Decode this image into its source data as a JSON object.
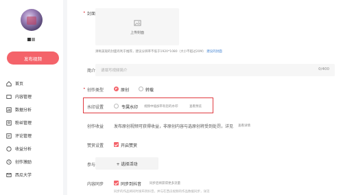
{
  "sidebar": {
    "publish_label": "发布视频",
    "items": [
      {
        "label": "首页",
        "icon": "home-icon"
      },
      {
        "label": "内容管理",
        "icon": "content-icon"
      },
      {
        "label": "数据分析",
        "icon": "chart-icon"
      },
      {
        "label": "粉丝管理",
        "icon": "fans-icon"
      },
      {
        "label": "评论管理",
        "icon": "comment-icon"
      },
      {
        "label": "收益分析",
        "icon": "income-icon"
      },
      {
        "label": "创作激励",
        "icon": "incentive-icon"
      },
      {
        "label": "西瓜大学",
        "icon": "school-icon"
      }
    ]
  },
  "form": {
    "cover": {
      "label": "封面",
      "upload_text": "上传封面",
      "hint": "清晰美观的封面有利于推荐，建议分辨率不低于1920*1080（大小不超过20M）",
      "hint_link": "建议的封面"
    },
    "intro": {
      "label": "简介",
      "placeholder": "请填写视频简介",
      "count": "0/400"
    },
    "creation_type": {
      "label": "创作类型",
      "options": [
        "原创",
        "转载"
      ],
      "selected": "原创"
    },
    "watermark": {
      "label": "水印设置",
      "option": "专属水印",
      "desc": "视频中插加带有您的水印",
      "link": "查看预览"
    },
    "income": {
      "label": "创作收益",
      "text": "发布原创视频可获得收益，非原创内容与选原创将受到处罚，详见",
      "link": "查看详情"
    },
    "reward": {
      "label": "赞赏设置",
      "option": "开启赞赏"
    },
    "activity": {
      "label": "参与活动",
      "button": "+ 选择活动"
    },
    "sync": {
      "label": "内容同步",
      "option": "同步到抖音",
      "desc": "同步后将获得更多流量",
      "note": "同步的作品将同时发布到抖音，并与在西瓜视频的作品数据同步，详见"
    }
  }
}
